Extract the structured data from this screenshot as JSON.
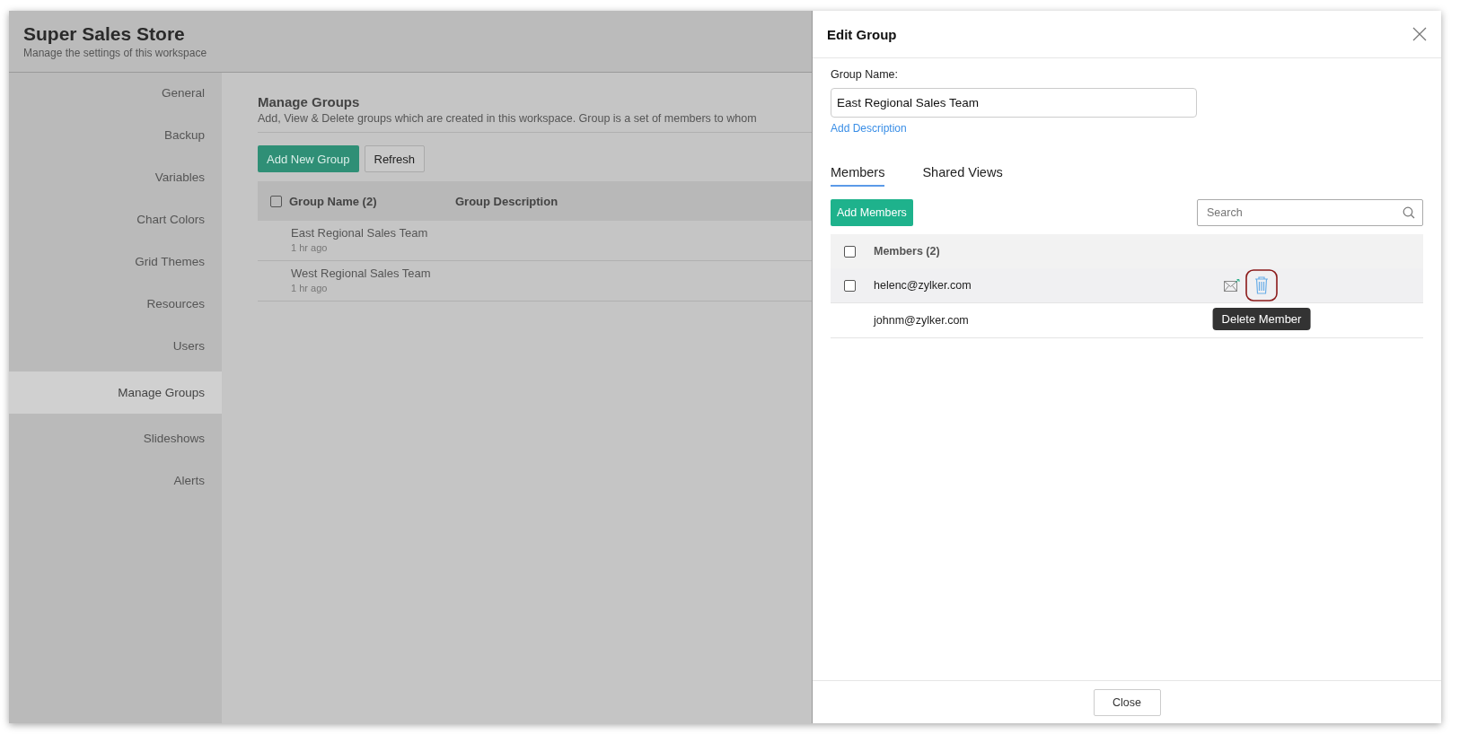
{
  "workspace": {
    "title": "Super Sales Store",
    "subtitle": "Manage the settings of this workspace"
  },
  "sidebar": {
    "items": [
      {
        "label": "General",
        "selected": false
      },
      {
        "label": "Backup",
        "selected": false
      },
      {
        "label": "Variables",
        "selected": false
      },
      {
        "label": "Chart Colors",
        "selected": false
      },
      {
        "label": "Grid Themes",
        "selected": false
      },
      {
        "label": "Resources",
        "selected": false
      },
      {
        "label": "Users",
        "selected": false
      },
      {
        "label": "Manage Groups",
        "selected": true
      },
      {
        "label": "Slideshows",
        "selected": false
      },
      {
        "label": "Alerts",
        "selected": false
      }
    ]
  },
  "manage_groups": {
    "title": "Manage Groups",
    "description": "Add, View & Delete groups which are created in this workspace. Group is a set of members to whom",
    "buttons": [
      {
        "kind": "primary",
        "label": "Add New Group"
      },
      {
        "kind": "secondary",
        "label": "Refresh"
      }
    ],
    "table": {
      "select_all_checked": false,
      "columns": [
        "Group Name (2)",
        "Group Description"
      ],
      "rows": [
        {
          "name": "East Regional Sales Team",
          "time": "1 hr ago"
        },
        {
          "name": "West Regional Sales Team",
          "time": "1 hr ago"
        }
      ]
    }
  },
  "edit_group": {
    "title": "Edit Group",
    "name_label": "Group Name:",
    "name_value": "East Regional Sales Team",
    "add_description": "Add Description",
    "tabs": [
      {
        "label": "Members",
        "selected": true
      },
      {
        "label": "Shared Views",
        "selected": false
      }
    ],
    "add_members": "Add Members",
    "search": {
      "placeholder": "Search"
    },
    "members": {
      "select_all_checked": false,
      "header": "Members (2)",
      "rows": [
        {
          "email": "helenc@zylker.com",
          "hovered": true,
          "tooltip": "Delete Member"
        },
        {
          "email": "johnm@zylker.com",
          "hovered": false
        }
      ]
    },
    "close": "Close"
  }
}
